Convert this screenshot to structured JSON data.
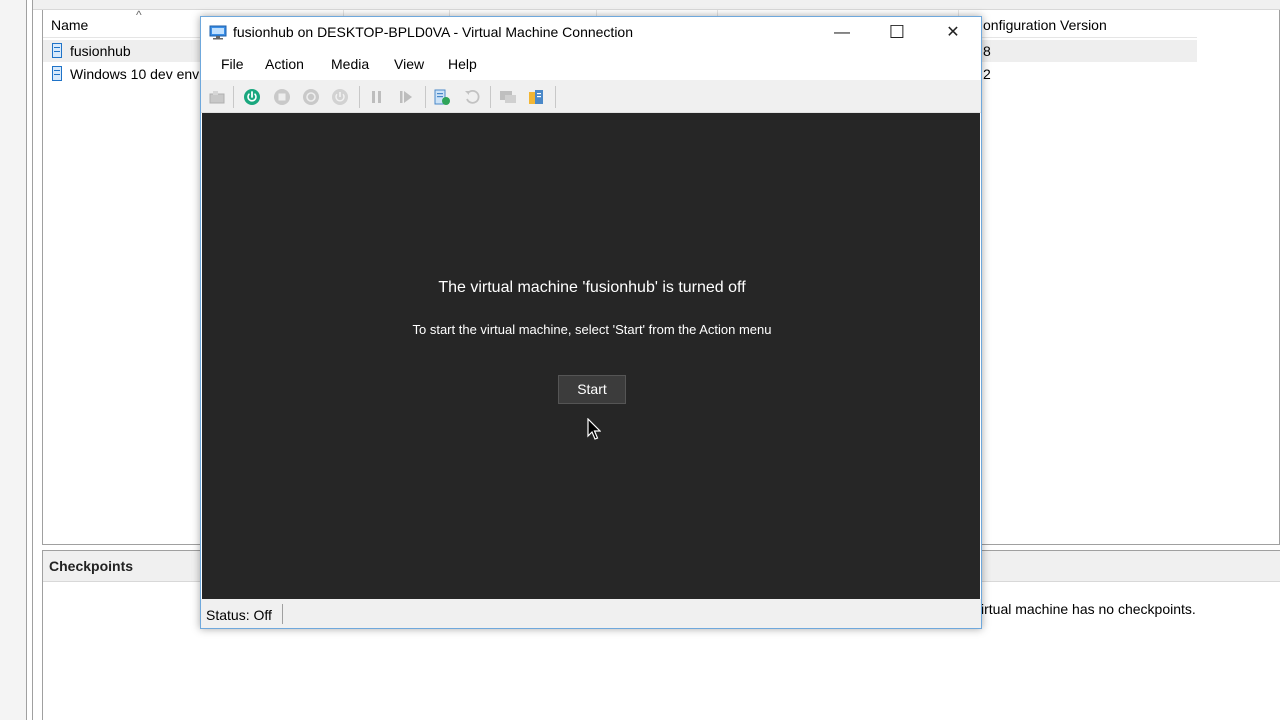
{
  "background": {
    "list_header": {
      "name": "Name",
      "sort_caret": "^",
      "configuration_version": "onfiguration Version"
    },
    "vms": [
      {
        "name": "fusionhub",
        "version": "8",
        "selected": true
      },
      {
        "name": "Windows 10 dev envi",
        "version": "2",
        "selected": false
      }
    ],
    "checkpoints": {
      "title": "Checkpoints",
      "message": "irtual machine has no checkpoints."
    }
  },
  "window": {
    "title": "fusionhub on DESKTOP-BPLD0VA - Virtual Machine Connection",
    "controls": {
      "minimize": "—",
      "maximize": "☐",
      "close": "✕"
    },
    "menu": [
      "File",
      "Action",
      "Media",
      "View",
      "Help"
    ],
    "toolbar_icons": [
      "ctrl-alt-del-icon",
      "start-icon",
      "turn-off-icon",
      "shut-down-icon",
      "save-icon",
      "pause-icon",
      "reset-icon",
      "checkpoint-icon",
      "revert-icon",
      "enhanced-session-icon",
      "share-icon"
    ],
    "screen": {
      "heading": "The virtual machine 'fusionhub' is turned off",
      "instruction": "To start the virtual machine, select 'Start' from the Action menu",
      "start_button": "Start"
    },
    "status": "Status: Off"
  },
  "colors": {
    "screen_bg": "#262626",
    "start_icon": "#1aa77e",
    "accent_border": "#6fa8dc"
  }
}
